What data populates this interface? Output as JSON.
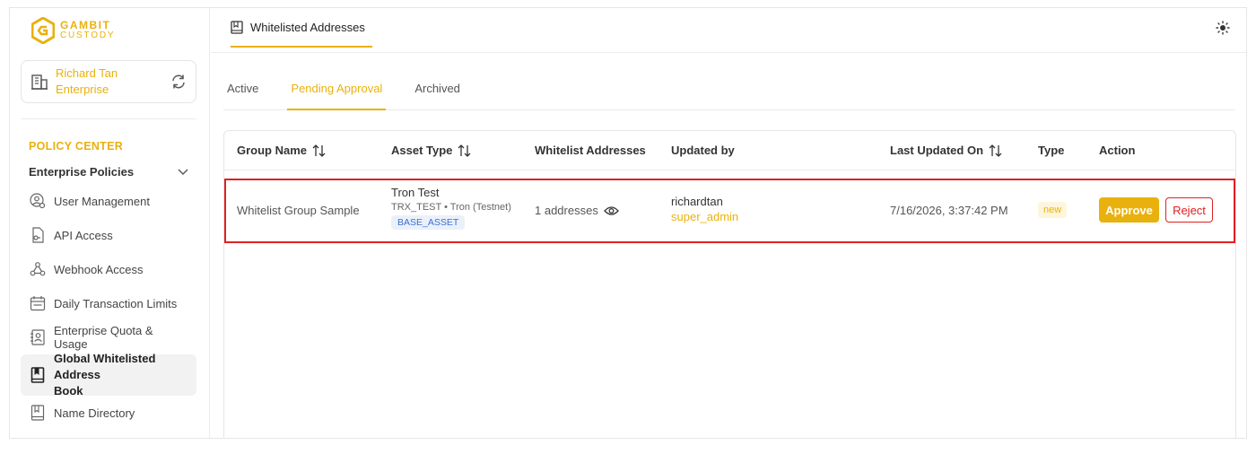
{
  "brand": {
    "name": "GAMBIT",
    "sub": "CUSTODY",
    "color": "#e9b10d"
  },
  "enterprise": {
    "name_line1": "Richard Tan",
    "name_line2": "Enterprise"
  },
  "sidebar": {
    "section_title": "POLICY CENTER",
    "group_title": "Enterprise Policies",
    "items": [
      {
        "label": "User Management",
        "icon": "user-gear-icon"
      },
      {
        "label": "API Access",
        "icon": "file-key-icon"
      },
      {
        "label": "Webhook Access",
        "icon": "webhook-icon"
      },
      {
        "label": "Daily Transaction Limits",
        "icon": "calendar-icon"
      },
      {
        "label": "Enterprise Quota & Usage",
        "icon": "contact-book-icon"
      },
      {
        "label_line1": "Global Whitelisted Address",
        "label_line2": "Book",
        "icon": "address-book-icon",
        "active": true
      },
      {
        "label": "Name Directory",
        "icon": "book-icon"
      }
    ]
  },
  "topbar": {
    "page_tab": "Whitelisted Addresses"
  },
  "tabs": [
    {
      "label": "Active"
    },
    {
      "label": "Pending Approval",
      "active": true
    },
    {
      "label": "Archived"
    }
  ],
  "table": {
    "headers": {
      "group_name": "Group Name",
      "asset_type": "Asset Type",
      "whitelist_addresses": "Whitelist Addresses",
      "updated_by": "Updated by",
      "last_updated_on": "Last Updated On",
      "type": "Type",
      "action": "Action"
    },
    "rows": [
      {
        "group_name": "Whitelist Group Sample",
        "asset_name": "Tron Test",
        "asset_sub": "TRX_TEST • Tron (Testnet)",
        "asset_badge": "BASE_ASSET",
        "addresses": "1 addresses",
        "updated_by_name": "richardtan",
        "updated_by_role": "super_admin",
        "last_updated_on": "7/16/2026, 3:37:42 PM",
        "type": "new",
        "approve_label": "Approve",
        "reject_label": "Reject"
      }
    ]
  }
}
